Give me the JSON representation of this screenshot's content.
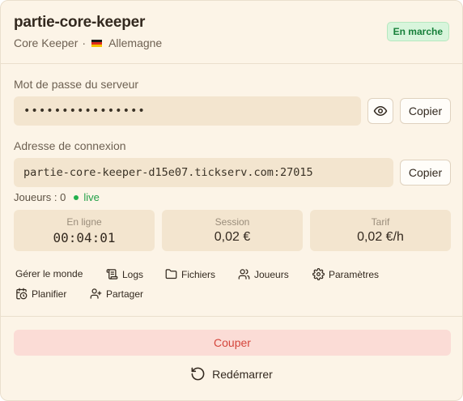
{
  "server": {
    "name": "partie-core-keeper",
    "game": "Core Keeper",
    "separator": "·",
    "country": "Allemagne",
    "status": "En marche"
  },
  "password": {
    "label": "Mot de passe du serveur",
    "masked_value": "••••••••••••••••",
    "copy_label": "Copier"
  },
  "connection": {
    "label": "Adresse de connexion",
    "address": "partie-core-keeper-d15e07.tickserv.com:27015",
    "copy_label": "Copier"
  },
  "players": {
    "text": "Joueurs : 0",
    "live_label": "live"
  },
  "stats": [
    {
      "label": "En ligne",
      "value": "00:04:01"
    },
    {
      "label": "Session",
      "value": "0,02 €"
    },
    {
      "label": "Tarif",
      "value": "0,02 €/h"
    }
  ],
  "actions": {
    "manage": "Gérer le monde",
    "logs": "Logs",
    "files": "Fichiers",
    "players": "Joueurs",
    "settings": "Paramètres",
    "schedule": "Planifier",
    "share": "Partager"
  },
  "controls": {
    "stop_label": "Couper",
    "restart_label": "Redémarrer"
  },
  "colors": {
    "background": "#fcf4e7",
    "status_green": "#17803a",
    "danger": "#d4463c",
    "field_bg": "#f3e5cf"
  },
  "icons": [
    "eye-icon",
    "logs-icon",
    "folder-icon",
    "users-icon",
    "gear-icon",
    "calendar-clock-icon",
    "user-plus-icon",
    "restart-icon",
    "germany-flag-icon"
  ]
}
